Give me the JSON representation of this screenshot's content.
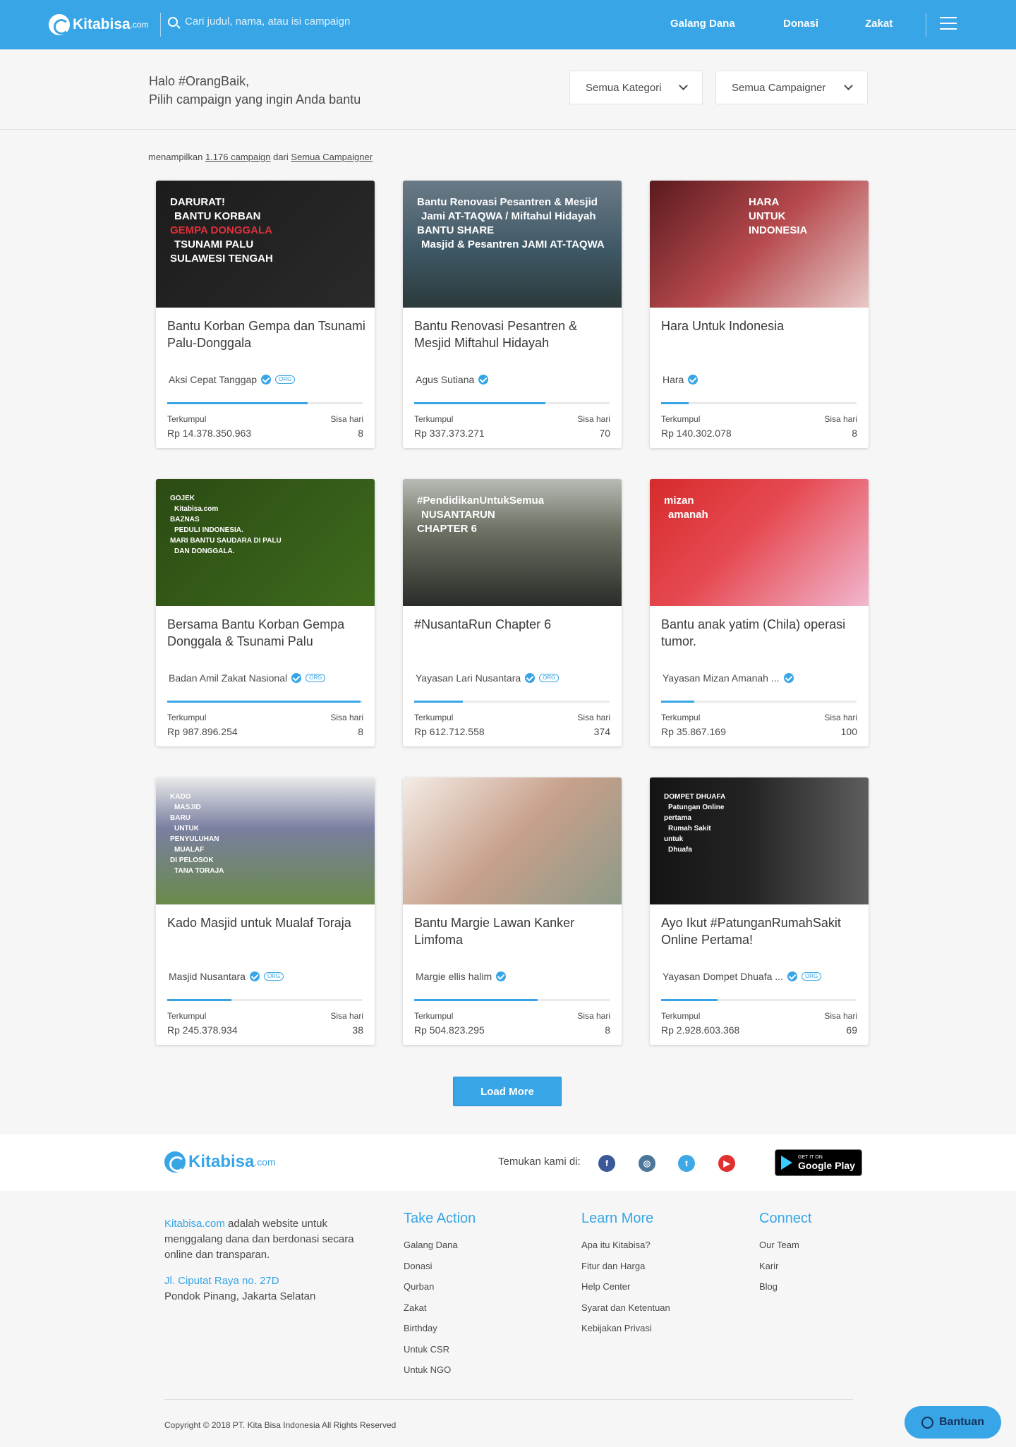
{
  "header": {
    "logo_name": "Kitabisa",
    "logo_suffix": ".com",
    "search_placeholder": "Cari judul, nama, atau isi campaign",
    "nav": [
      "Galang Dana",
      "Donasi",
      "Zakat"
    ],
    "accent": "#37a5e6"
  },
  "filter": {
    "greeting_line1": "Halo #OrangBaik,",
    "greeting_line2": "Pilih campaign yang ingin Anda bantu",
    "category": "Semua Kategori",
    "campaigner": "Semua Campaigner"
  },
  "summary": {
    "prefix": "menampilkan",
    "count": "1.176 campaign",
    "middle": "dari",
    "source": "Semua Campaigner"
  },
  "labels": {
    "collected": "Terkumpul",
    "days_left": "Sisa hari"
  },
  "campaigns": [
    {
      "title": "Bantu Korban Gempa dan Tsunami Palu-Donggala",
      "organizer": "Aksi Cepat Tanggap",
      "org_badge": "ORG",
      "amount": "Rp 14.378.350.963",
      "days": "8",
      "progress": 0.72,
      "image_text": [
        "DARURAT!",
        "BANTU KORBAN",
        "GEMPA DONGGALA",
        "TSUNAMI PALU",
        "SULAWESI TENGAH"
      ]
    },
    {
      "title": "Bantu Renovasi Pesantren & Mesjid Miftahul Hidayah",
      "organizer": "Agus Sutiana",
      "org_badge": "",
      "amount": "Rp 337.373.271",
      "days": "70",
      "progress": 0.67,
      "image_text": [
        "Bantu Renovasi Pesantren & Mesjid",
        "Jami AT-TAQWA / Miftahul Hidayah",
        "BANTU SHARE",
        "Masjid & Pesantren JAMI AT-TAQWA"
      ]
    },
    {
      "title": "Hara Untuk Indonesia",
      "organizer": "Hara",
      "org_badge": "",
      "amount": "Rp 140.302.078",
      "days": "8",
      "progress": 0.14,
      "image_text": [
        "HARA",
        "UNTUK",
        "INDONESIA"
      ]
    },
    {
      "title": "Bersama Bantu Korban Gempa Donggala & Tsunami Palu",
      "organizer": "Badan Amil Zakat Nasional",
      "org_badge": "ORG",
      "amount": "Rp 987.896.254",
      "days": "8",
      "progress": 0.99,
      "image_text": [
        "GOJEK",
        "Kitabisa.com",
        "BAZNAS",
        "PEDULI INDONESIA.",
        "MARI BANTU SAUDARA DI PALU",
        "DAN DONGGALA."
      ]
    },
    {
      "title": "#NusantaRun Chapter 6",
      "organizer": "Yayasan Lari Nusantara",
      "org_badge": "ORG",
      "amount": "Rp 612.712.558",
      "days": "374",
      "progress": 0.25,
      "image_text": [
        "#PendidikanUntukSemua",
        "NUSANTARUN",
        "CHAPTER 6"
      ]
    },
    {
      "title": "Bantu anak yatim (Chila) operasi tumor.",
      "organizer": "Yayasan Mizan Amanah ...",
      "org_badge": "",
      "amount": "Rp 35.867.169",
      "days": "100",
      "progress": 0.17,
      "image_text": [
        "mizan",
        "amanah"
      ]
    },
    {
      "title": "Kado Masjid untuk Mualaf Toraja",
      "organizer": "Masjid Nusantara",
      "org_badge": "ORG",
      "amount": "Rp 245.378.934",
      "days": "38",
      "progress": 0.33,
      "image_text": [
        "KADO",
        "MASJID",
        "BARU",
        "UNTUK",
        "PENYULUHAN",
        "MUALAF",
        "DI PELOSOK",
        "TANA TORAJA"
      ]
    },
    {
      "title": "Bantu Margie Lawan Kanker Limfoma",
      "organizer": "Margie ellis halim",
      "org_badge": "",
      "amount": "Rp 504.823.295",
      "days": "8",
      "progress": 0.63,
      "image_text": []
    },
    {
      "title": "Ayo Ikut #PatunganRumahSakit Online Pertama!",
      "organizer": "Yayasan Dompet Dhuafa ...",
      "org_badge": "ORG",
      "amount": "Rp 2.928.603.368",
      "days": "69",
      "progress": 0.29,
      "image_text": [
        "DOMPET DHUAFA",
        "Patungan Online",
        "pertama",
        "Rumah Sakit",
        "untuk",
        "Dhuafa"
      ]
    }
  ],
  "load_more": "Load More",
  "footer": {
    "find_us": "Temukan kami di:",
    "play_small": "GET IT ON",
    "play_big": "Google Play",
    "about_brand": "Kitabisa.com",
    "about_text": "adalah website untuk menggalang dana dan berdonasi secara online dan transparan.",
    "address_line1": "Jl. Ciputat Raya no. 27D",
    "address_line2": "Pondok Pinang, Jakarta Selatan",
    "columns": [
      {
        "title": "Take Action",
        "links": [
          "Galang Dana",
          "Donasi",
          "Qurban",
          "Zakat",
          "Birthday",
          "Untuk CSR",
          "Untuk NGO"
        ]
      },
      {
        "title": "Learn More",
        "links": [
          "Apa itu Kitabisa?",
          "Fitur dan Harga",
          "Help Center",
          "Syarat dan Ketentuan",
          "Kebijakan Privasi"
        ]
      },
      {
        "title": "Connect",
        "links": [
          "Our Team",
          "Karir",
          "Blog"
        ]
      }
    ],
    "copyright": "Copyright © 2018 PT. Kita Bisa Indonesia All Rights Reserved",
    "help_button": "Bantuan",
    "social": [
      {
        "icon": "facebook-icon",
        "glyph": "f",
        "color": "#3b5998"
      },
      {
        "icon": "instagram-icon",
        "glyph": "◎",
        "color": "#4b7599"
      },
      {
        "icon": "twitter-icon",
        "glyph": "t",
        "color": "#3fa8e6"
      },
      {
        "icon": "youtube-icon",
        "glyph": "▶",
        "color": "#e0302f"
      }
    ]
  }
}
